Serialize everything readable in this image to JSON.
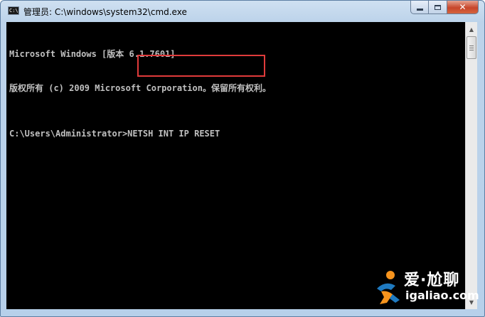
{
  "window": {
    "title_prefix": "管理员: ",
    "title_path": "C:\\windows\\system32\\cmd.exe",
    "icon_label": "C:\\",
    "minimize_icon": "minimize-icon",
    "maximize_icon": "maximize-icon",
    "close_glyph": "✕"
  },
  "console": {
    "lines": [
      "Microsoft Windows [版本 6.1.7601]",
      "版权所有 (c) 2009 Microsoft Corporation。保留所有权利。"
    ],
    "prompt": "C:\\Users\\Administrator>",
    "command": "NETSH INT IP RESET",
    "highlight_color": "#e03b3b"
  },
  "scrollbar": {
    "up_arrow": "▲",
    "down_arrow": "▼"
  },
  "watermark": {
    "title": "爱·尬聊",
    "url": "igaliao.com"
  }
}
